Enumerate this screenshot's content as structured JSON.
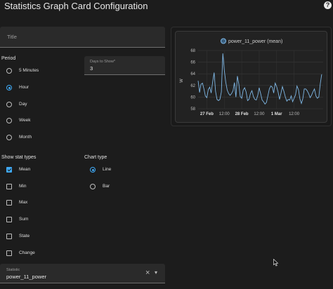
{
  "header": {
    "title": "Statistics Graph Card Configuration",
    "help_icon": "?"
  },
  "title_field": {
    "placeholder": "Title",
    "value": ""
  },
  "period": {
    "label": "Period",
    "options": [
      "5 Minutes",
      "Hour",
      "Day",
      "Week",
      "Month"
    ],
    "selected": "Hour"
  },
  "days_to_show": {
    "label": "Days to Show*",
    "value": "3"
  },
  "stat_types": {
    "label": "Show stat types",
    "options": [
      "Mean",
      "Min",
      "Max",
      "Sum",
      "State",
      "Change"
    ],
    "checked": [
      "Mean"
    ]
  },
  "chart_type": {
    "label": "Chart type",
    "options": [
      "Line",
      "Bar"
    ],
    "selected": "Line"
  },
  "statistic": {
    "label": "Statistic",
    "value": "power_11_power",
    "clear_icon": "×",
    "dropdown_icon": "▾"
  },
  "colors": {
    "accent": "#3fa9f5",
    "series": "#7fb8e6",
    "background": "#1c1c1c"
  },
  "chart_data": {
    "type": "line",
    "title": "",
    "legend": "top-center",
    "xlabel": "",
    "ylabel": "W",
    "ylim": [
      58,
      68
    ],
    "y_ticks": [
      "68",
      "66",
      "64",
      "62",
      "60",
      "58"
    ],
    "x_ticks": [
      "27 Feb",
      "12:00",
      "28 Feb",
      "12:00",
      "1 Mar",
      "12:00"
    ],
    "x_ticks_bold": [
      "27 Feb",
      "28 Feb",
      "1 Mar"
    ],
    "grid": true,
    "series": [
      {
        "name": "power_11_power (mean)",
        "x_hours": [
          0,
          1,
          2,
          3,
          4,
          5,
          6,
          7,
          8,
          9,
          10,
          11,
          12,
          13,
          14,
          15,
          16,
          17,
          18,
          19,
          20,
          21,
          22,
          23,
          24,
          25,
          26,
          27,
          28,
          29,
          30,
          31,
          32,
          33,
          34,
          35,
          36,
          37,
          38,
          39,
          40,
          41,
          42,
          43,
          44,
          45,
          46,
          47,
          48,
          49,
          50,
          51,
          52,
          53,
          54,
          55,
          56,
          57,
          58,
          59,
          60,
          61,
          62,
          63,
          64,
          65,
          66,
          67,
          68,
          69,
          70,
          71,
          72,
          73,
          74,
          75,
          76,
          77,
          78,
          79,
          80,
          81,
          82,
          83,
          84,
          85
        ],
        "values": [
          62.8,
          60.8,
          62.2,
          62.4,
          61.4,
          60.2,
          59.9,
          61.3,
          61.7,
          60.7,
          62.6,
          64.2,
          61.0,
          59.6,
          59.4,
          59.6,
          60.9,
          67.5,
          64.6,
          62.6,
          61.2,
          60.6,
          60.3,
          60.6,
          61.1,
          62.5,
          60.0,
          63.6,
          62.2,
          60.1,
          59.8,
          61.2,
          61.6,
          60.9,
          59.4,
          59.6,
          60.6,
          61.1,
          60.1,
          59.6,
          59.5,
          60.3,
          61.6,
          60.6,
          59.5,
          59.2,
          58.8,
          59.1,
          60.2,
          61.4,
          61.9,
          61.7,
          60.7,
          62.4,
          61.8,
          60.9,
          59.6,
          60.7,
          61.8,
          61.0,
          60.0,
          59.3,
          59.6,
          59.5,
          60.2,
          59.2,
          59.8,
          60.4,
          61.9,
          61.3,
          59.7,
          58.9,
          59.7,
          61.4,
          61.4,
          61.1,
          60.6,
          59.9,
          60.3,
          60.9,
          61.4,
          60.2,
          59.8,
          60.0,
          62.3,
          63.9
        ]
      }
    ]
  }
}
